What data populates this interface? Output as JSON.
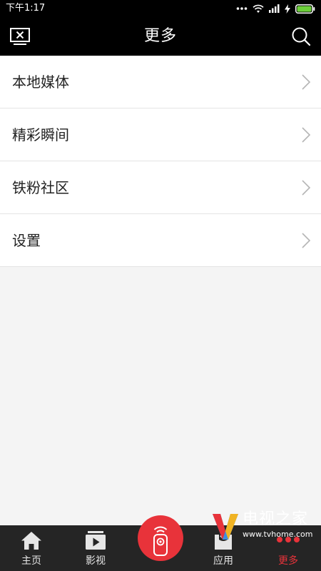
{
  "status_bar": {
    "time": "下午1:17",
    "icons": [
      "more-dots-icon",
      "wifi-icon",
      "signal-icon",
      "charging-icon",
      "battery-icon"
    ]
  },
  "header": {
    "title": "更多",
    "left_icon": "tv-cast-icon",
    "right_icon": "search-icon"
  },
  "menu": {
    "items": [
      {
        "label": "本地媒体",
        "icon": "chevron-right-icon"
      },
      {
        "label": "精彩瞬间",
        "icon": "chevron-right-icon"
      },
      {
        "label": "铁粉社区",
        "icon": "chevron-right-icon"
      },
      {
        "label": "设置",
        "icon": "chevron-right-icon"
      }
    ]
  },
  "bottom_nav": {
    "items": [
      {
        "label": "主页",
        "icon": "home-icon"
      },
      {
        "label": "影视",
        "icon": "video-icon"
      },
      {
        "label": "",
        "icon": "remote-icon"
      },
      {
        "label": "应用",
        "icon": "apps-icon"
      },
      {
        "label": "更多",
        "icon": "more-dots-icon",
        "active": true
      }
    ]
  },
  "watermark": {
    "text": "电视之家",
    "url": "www.tvhome.com"
  },
  "colors": {
    "accent": "#e8333a",
    "bar_background": "#000000",
    "nav_background": "#252525",
    "page_background": "#f4f4f4"
  }
}
